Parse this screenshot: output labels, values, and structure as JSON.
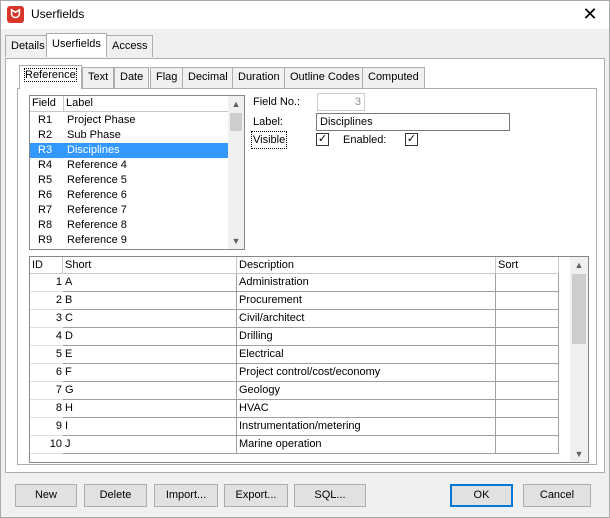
{
  "window": {
    "title": "Userfields",
    "close_glyph": "✕"
  },
  "outer_tabs": [
    {
      "label": "Details"
    },
    {
      "label": "Userfields",
      "active": true
    },
    {
      "label": "Access"
    }
  ],
  "inner_tabs": [
    {
      "label": "Reference",
      "active": true
    },
    {
      "label": "Text"
    },
    {
      "label": "Date"
    },
    {
      "label": "Flag"
    },
    {
      "label": "Decimal"
    },
    {
      "label": "Duration"
    },
    {
      "label": "Outline Codes"
    },
    {
      "label": "Computed"
    }
  ],
  "field_list": {
    "headers": {
      "field": "Field",
      "label": "Label"
    },
    "rows": [
      {
        "field": "R1",
        "label": "Project Phase"
      },
      {
        "field": "R2",
        "label": "Sub Phase"
      },
      {
        "field": "R3",
        "label": "Disciplines",
        "selected": true
      },
      {
        "field": "R4",
        "label": "Reference 4"
      },
      {
        "field": "R5",
        "label": "Reference 5"
      },
      {
        "field": "R6",
        "label": "Reference 6"
      },
      {
        "field": "R7",
        "label": "Reference 7"
      },
      {
        "field": "R8",
        "label": "Reference 8"
      },
      {
        "field": "R9",
        "label": "Reference 9"
      }
    ]
  },
  "form": {
    "field_no_label": "Field No.:",
    "field_no_value": "3",
    "label_label": "Label:",
    "label_value": "Disciplines",
    "visible_label": "Visible",
    "visible_checked": true,
    "enabled_label": "Enabled:",
    "enabled_checked": true,
    "check_glyph": "✓"
  },
  "codes_grid": {
    "headers": {
      "id": "ID",
      "short": "Short",
      "description": "Description",
      "sort": "Sort"
    },
    "rows": [
      {
        "id": "1",
        "short": "A",
        "description": "Administration",
        "sort": ""
      },
      {
        "id": "2",
        "short": "B",
        "description": "Procurement",
        "sort": ""
      },
      {
        "id": "3",
        "short": "C",
        "description": "Civil/architect",
        "sort": ""
      },
      {
        "id": "4",
        "short": "D",
        "description": "Drilling",
        "sort": ""
      },
      {
        "id": "5",
        "short": "E",
        "description": "Electrical",
        "sort": ""
      },
      {
        "id": "6",
        "short": "F",
        "description": "Project control/cost/economy",
        "sort": ""
      },
      {
        "id": "7",
        "short": "G",
        "description": "Geology",
        "sort": ""
      },
      {
        "id": "8",
        "short": "H",
        "description": "HVAC",
        "sort": ""
      },
      {
        "id": "9",
        "short": "I",
        "description": "Instrumentation/metering",
        "sort": ""
      },
      {
        "id": "10",
        "short": "J",
        "description": "Marine operation",
        "sort": ""
      }
    ]
  },
  "buttons": {
    "new": "New",
    "delete": "Delete",
    "import": "Import...",
    "export": "Export...",
    "sql": "SQL...",
    "ok": "OK",
    "cancel": "Cancel"
  },
  "colors": {
    "selection": "#3399ff",
    "default_button_border": "#0078d7",
    "app_icon": "#d9362b"
  }
}
